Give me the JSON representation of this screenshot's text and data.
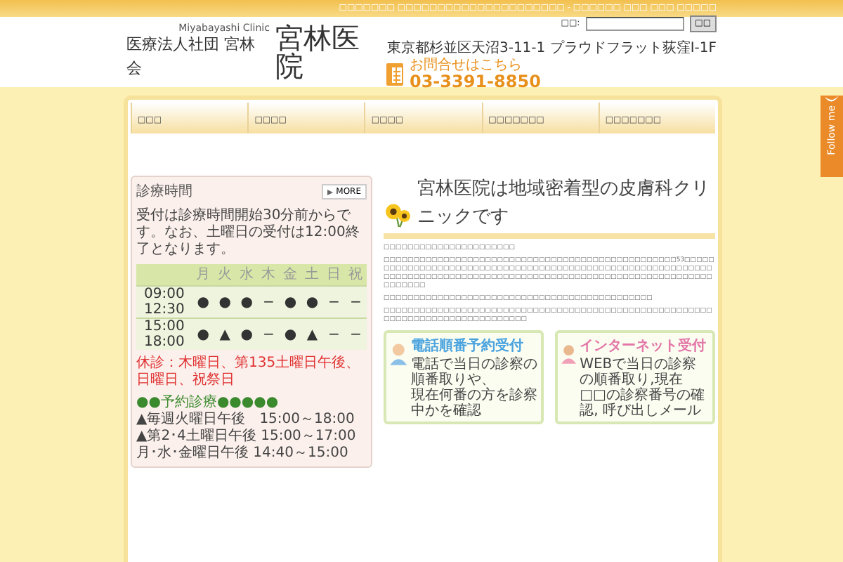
{
  "top_bar": {
    "text": "□□□□□□□ □□□□□□□□□□□□□□□□□□□□□ - □□□□□□ □□□ □□□ □□□□□"
  },
  "header": {
    "logo_subtitle": "Miyabayashi Clinic",
    "logo_org": "医療法人社団 宮林会",
    "logo_name": "宮林医院",
    "search_label": "□□:",
    "search_button": "□□",
    "address": "東京都杉並区天沼3-11-1 プラウドフラット荻窪I-1F",
    "contact_label": "お問合せはこちら",
    "phone": "03-3391-8850"
  },
  "nav": [
    {
      "label": "□□□"
    },
    {
      "label": "□□□□"
    },
    {
      "label": "□□□□"
    },
    {
      "label": "□□□□□□□"
    },
    {
      "label": "□□□□□□□"
    }
  ],
  "hours": {
    "title": "診療時間",
    "more": "MORE",
    "note": "受付は診療時間開始30分前からです。なお、土曜日の受付は12:00終了となります。",
    "days": [
      "月",
      "火",
      "水",
      "木",
      "金",
      "土",
      "日",
      "祝"
    ],
    "rows": [
      {
        "time": [
          "09:00",
          "12:30"
        ],
        "marks": [
          "●",
          "●",
          "●",
          "−",
          "●",
          "●",
          "−",
          "−"
        ]
      },
      {
        "time": [
          "15:00",
          "18:00"
        ],
        "marks": [
          "●",
          "▲",
          "●",
          "−",
          "●",
          "▲",
          "−",
          "−"
        ]
      }
    ],
    "closed": "休診：木曜日、第135土曜日午後、日曜日、祝祭日",
    "reservation_title": "●●予約診療●●●●●",
    "reservation_lines": [
      "▲毎週火曜日午後　15:00～18:00",
      "▲第2･4土曜日午後 15:00～17:00",
      "月･水･金曜日午後 14:40～15:00"
    ]
  },
  "intro": {
    "heading": "宮林医院は地域密着型の皮膚科クリニックです",
    "paragraphs": [
      "□□□□□□□□□□□□□□□□□□□□□□",
      "□□□□□□□□□□□□□□□□□□□□□□□□□□□□□□□□□□□□□□□□□□□□□□□□□53□□□□□□□□□□□□□□□□□□□□□□□□□□□□□□□□□□□□□□□□□□□□□□□□□□□□□□□□□□□□□□□□□□□□□□□□□□□□□□□□□□□□□□□□□□□□□□□□□□□□□□□□□□□□□□□□□□□□□□□□□□",
      "□□□□□□□□□□□□□□□□□□□□□□□□□□□□□□□□□□□□□□□□□□□□□",
      "□□□□□□□□□□□□□□□□□□□□□□□□□□□□□□□□□□□□□□□□□□□□□□□□□□□□□□□□□□□□□□□□□□□□□□□□□□□□□□□"
    ]
  },
  "banners": [
    {
      "title": "電話順番予約受付",
      "color": "#4aa3df",
      "lines": [
        "電話で当日の診察の順番取りや、",
        "現在何番の方を診察中かを確認"
      ]
    },
    {
      "title": "インターネット受付",
      "color": "#e377a8",
      "lines": [
        "WEBで当日の診察の順番取り,現在",
        "□□の診察番号の確認, 呼び出しメール"
      ]
    }
  ],
  "follow_tab": {
    "label": "Follow me"
  }
}
